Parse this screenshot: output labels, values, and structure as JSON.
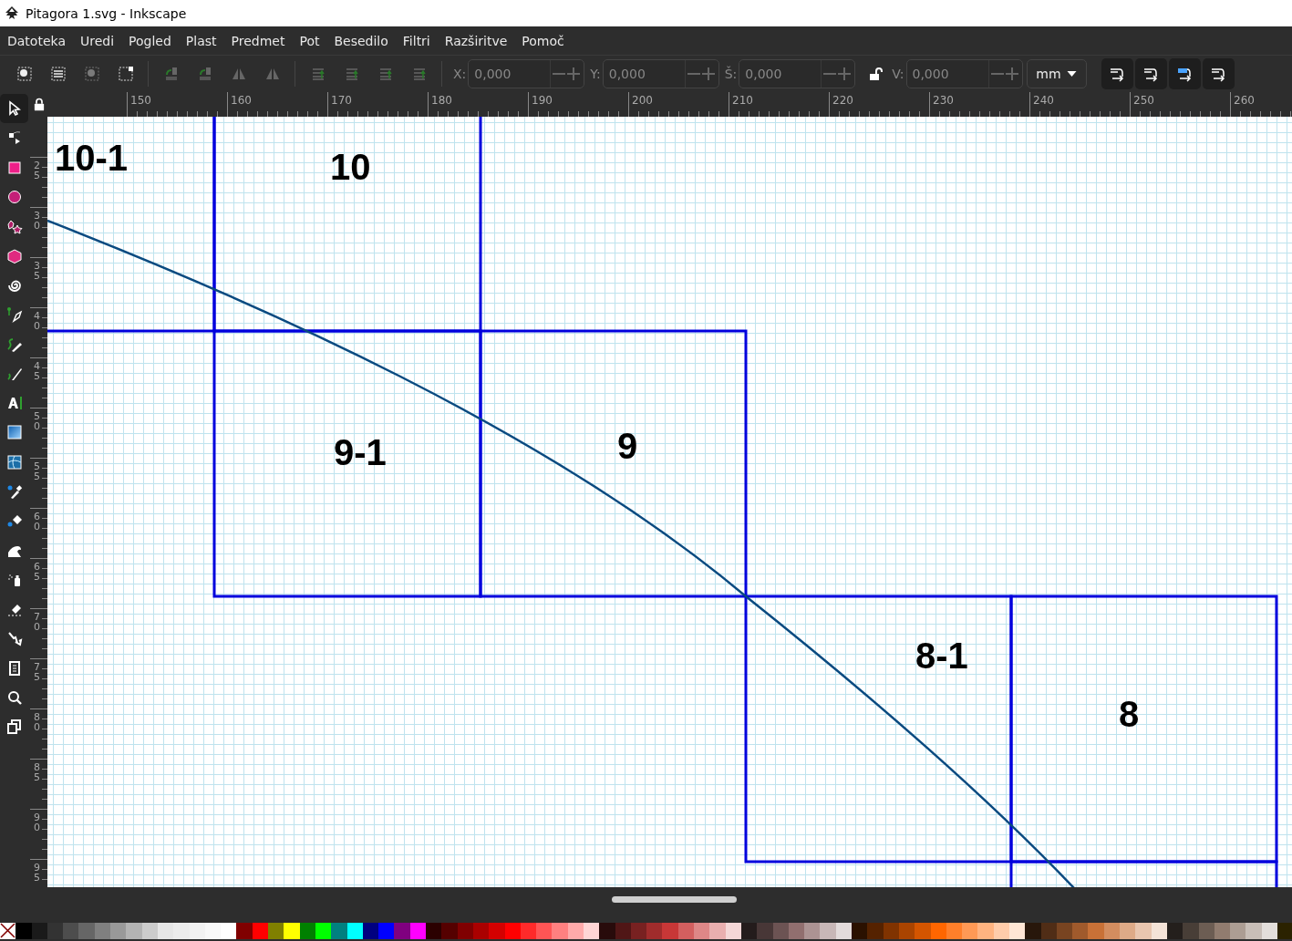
{
  "window": {
    "title": "Pitagora 1.svg - Inkscape"
  },
  "menu": [
    "Datoteka",
    "Uredi",
    "Pogled",
    "Plast",
    "Predmet",
    "Pot",
    "Besedilo",
    "Filtri",
    "Razširitve",
    "Pomoč"
  ],
  "toolbar": {
    "fields": [
      {
        "label": "X:",
        "value": "0,000"
      },
      {
        "label": "Y:",
        "value": "0,000"
      },
      {
        "label": "Š:",
        "value": "0,000"
      },
      {
        "label": "V:",
        "value": "0,000"
      }
    ],
    "unit": "mm"
  },
  "tools": [
    {
      "kind": "select",
      "selected": true
    },
    {
      "kind": "node",
      "selected": false
    },
    {
      "kind": "rect",
      "selected": false
    },
    {
      "kind": "ellipse",
      "selected": false
    },
    {
      "kind": "star",
      "selected": false
    },
    {
      "kind": "box",
      "selected": false
    },
    {
      "kind": "spiral",
      "selected": false
    },
    {
      "kind": "pen",
      "selected": false
    },
    {
      "kind": "pencil",
      "selected": false
    },
    {
      "kind": "calligraphy",
      "selected": false
    },
    {
      "kind": "text",
      "selected": false
    },
    {
      "kind": "gradient",
      "selected": false
    },
    {
      "kind": "mesh",
      "selected": false
    },
    {
      "kind": "dropper",
      "selected": false
    },
    {
      "kind": "bucket",
      "selected": false
    },
    {
      "kind": "tweak",
      "selected": false
    },
    {
      "kind": "spray",
      "selected": false
    },
    {
      "kind": "eraser",
      "selected": false
    },
    {
      "kind": "connector",
      "selected": false
    },
    {
      "kind": "pages",
      "selected": false
    },
    {
      "kind": "zoom",
      "selected": false
    },
    {
      "kind": "clone",
      "selected": false
    }
  ],
  "rulers": {
    "horizontal": [
      "150",
      "160",
      "170",
      "180",
      "190",
      "200",
      "210",
      "220",
      "230",
      "240",
      "250",
      "260"
    ],
    "vertical": [
      "25",
      "30",
      "35",
      "40",
      "45",
      "50",
      "55",
      "60",
      "65",
      "70",
      "75",
      "80",
      "85",
      "90",
      "95"
    ]
  },
  "canvas": {
    "labels": [
      "10-1",
      "10",
      "9-1",
      "9",
      "8-1",
      "8"
    ]
  },
  "palette": [
    {
      "kind": "none",
      "color": "#ffffff"
    },
    {
      "kind": "swatch",
      "color": "#000000"
    },
    {
      "kind": "swatch",
      "color": "#1a1a1a"
    },
    {
      "kind": "swatch",
      "color": "#333333"
    },
    {
      "kind": "swatch",
      "color": "#4d4d4d"
    },
    {
      "kind": "swatch",
      "color": "#666666"
    },
    {
      "kind": "swatch",
      "color": "#808080"
    },
    {
      "kind": "swatch",
      "color": "#999999"
    },
    {
      "kind": "swatch",
      "color": "#b3b3b3"
    },
    {
      "kind": "swatch",
      "color": "#cccccc"
    },
    {
      "kind": "swatch",
      "color": "#e6e6e6"
    },
    {
      "kind": "swatch",
      "color": "#ececec"
    },
    {
      "kind": "swatch",
      "color": "#f2f2f2"
    },
    {
      "kind": "swatch",
      "color": "#f8f8f8"
    },
    {
      "kind": "swatch",
      "color": "#ffffff"
    },
    {
      "kind": "swatch",
      "color": "#800000"
    },
    {
      "kind": "swatch",
      "color": "#ff0000"
    },
    {
      "kind": "swatch",
      "color": "#808000"
    },
    {
      "kind": "swatch",
      "color": "#ffff00"
    },
    {
      "kind": "swatch",
      "color": "#008000"
    },
    {
      "kind": "swatch",
      "color": "#00ff00"
    },
    {
      "kind": "swatch",
      "color": "#008080"
    },
    {
      "kind": "swatch",
      "color": "#00ffff"
    },
    {
      "kind": "swatch",
      "color": "#000080"
    },
    {
      "kind": "swatch",
      "color": "#0000ff"
    },
    {
      "kind": "swatch",
      "color": "#800080"
    },
    {
      "kind": "swatch",
      "color": "#ff00ff"
    },
    {
      "kind": "swatch",
      "color": "#2b0000"
    },
    {
      "kind": "swatch",
      "color": "#550000"
    },
    {
      "kind": "swatch",
      "color": "#800001"
    },
    {
      "kind": "swatch",
      "color": "#aa0000"
    },
    {
      "kind": "swatch",
      "color": "#d40000"
    },
    {
      "kind": "swatch",
      "color": "#ff0001"
    },
    {
      "kind": "swatch",
      "color": "#ff2a2a"
    },
    {
      "kind": "swatch",
      "color": "#ff5555"
    },
    {
      "kind": "swatch",
      "color": "#ff8080"
    },
    {
      "kind": "swatch",
      "color": "#ffaaaa"
    },
    {
      "kind": "swatch",
      "color": "#ffd5d5"
    },
    {
      "kind": "swatch",
      "color": "#280b0b"
    },
    {
      "kind": "swatch",
      "color": "#501616"
    },
    {
      "kind": "swatch",
      "color": "#782121"
    },
    {
      "kind": "swatch",
      "color": "#a02c2c"
    },
    {
      "kind": "swatch",
      "color": "#c83737"
    },
    {
      "kind": "swatch",
      "color": "#d35f5f"
    },
    {
      "kind": "swatch",
      "color": "#de8787"
    },
    {
      "kind": "swatch",
      "color": "#e9afaf"
    },
    {
      "kind": "swatch",
      "color": "#f4d7d7"
    },
    {
      "kind": "swatch",
      "color": "#241c1c"
    },
    {
      "kind": "swatch",
      "color": "#483737"
    },
    {
      "kind": "swatch",
      "color": "#6c5353"
    },
    {
      "kind": "swatch",
      "color": "#916f6f"
    },
    {
      "kind": "swatch",
      "color": "#ac9393"
    },
    {
      "kind": "swatch",
      "color": "#c8b7b7"
    },
    {
      "kind": "swatch",
      "color": "#e3dbdb"
    },
    {
      "kind": "swatch",
      "color": "#2b1100"
    },
    {
      "kind": "swatch",
      "color": "#552200"
    },
    {
      "kind": "swatch",
      "color": "#803300"
    },
    {
      "kind": "swatch",
      "color": "#aa4400"
    },
    {
      "kind": "swatch",
      "color": "#d45500"
    },
    {
      "kind": "swatch",
      "color": "#ff6600"
    },
    {
      "kind": "swatch",
      "color": "#ff7f2a"
    },
    {
      "kind": "swatch",
      "color": "#ff9955"
    },
    {
      "kind": "swatch",
      "color": "#ffb380"
    },
    {
      "kind": "swatch",
      "color": "#ffccaa"
    },
    {
      "kind": "swatch",
      "color": "#ffe6d5"
    },
    {
      "kind": "swatch",
      "color": "#28170b"
    },
    {
      "kind": "swatch",
      "color": "#502d16"
    },
    {
      "kind": "swatch",
      "color": "#784421"
    },
    {
      "kind": "swatch",
      "color": "#a05a2c"
    },
    {
      "kind": "swatch",
      "color": "#c87137"
    },
    {
      "kind": "swatch",
      "color": "#d38d5f"
    },
    {
      "kind": "swatch",
      "color": "#deaa87"
    },
    {
      "kind": "swatch",
      "color": "#e9c6af"
    },
    {
      "kind": "swatch",
      "color": "#f4e3d7"
    },
    {
      "kind": "swatch",
      "color": "#241f1c"
    },
    {
      "kind": "swatch",
      "color": "#483e37"
    },
    {
      "kind": "swatch",
      "color": "#6c5d53"
    },
    {
      "kind": "swatch",
      "color": "#917c6f"
    },
    {
      "kind": "swatch",
      "color": "#ac9d93"
    },
    {
      "kind": "swatch",
      "color": "#c8beb7"
    },
    {
      "kind": "swatch",
      "color": "#e3dedb"
    },
    {
      "kind": "swatch",
      "color": "#2b2200"
    }
  ]
}
